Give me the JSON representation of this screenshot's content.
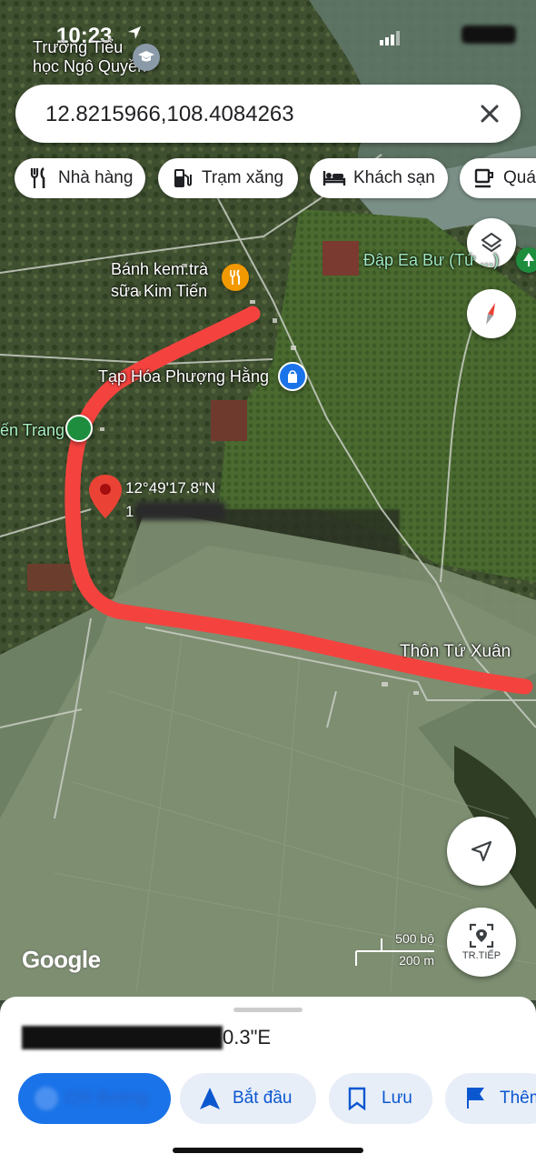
{
  "status_bar": {
    "time": "10:23"
  },
  "search": {
    "value": "12.8215966,108.4084263"
  },
  "chips": [
    {
      "label": "Nhà hàng",
      "icon": "fork-knife-icon"
    },
    {
      "label": "Trạm xăng",
      "icon": "gas-station-icon"
    },
    {
      "label": "Khách sạn",
      "icon": "bed-icon"
    },
    {
      "label": "Quán",
      "icon": "coffee-cup-icon"
    }
  ],
  "map": {
    "places": {
      "school": "Trường Tiểu học Ngô Quyền",
      "school_line1": "Trường Tiểu",
      "school_line2": "học Ngô Quyền",
      "dam": "Đập Ea Bư (Tứ ...)",
      "bakery_line1": "Bánh kem.trà",
      "bakery_line2": "sữa Kim Tiến",
      "grocery": "Tạp Hóa Phượng Hằng",
      "left_place": "ến Trang",
      "village": "Thôn Tứ Xuân"
    },
    "pin_label": "12°49'17.8\"N",
    "pin_label2": "1",
    "google_logo": "Google",
    "scale": {
      "imperial": "500 bộ",
      "metric": "200 m"
    },
    "next_label": "TR.TIẾP",
    "route_color": "#f4433f"
  },
  "sheet": {
    "coordinate_visible": "0.3\"E",
    "coordinate_redacted": "12°49'17.8\"N 108°24'3",
    "buttons": {
      "directions": "Chỉ đường",
      "start": "Bắt đầu",
      "save": "Lưu",
      "more": "Thêm"
    }
  }
}
